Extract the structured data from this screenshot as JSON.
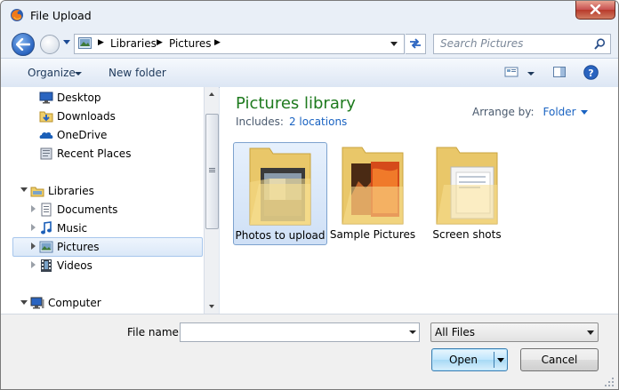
{
  "window": {
    "title": "File Upload",
    "icons": {
      "app": "firefox-icon",
      "close": "close-icon"
    }
  },
  "nav": {
    "breadcrumbs": [
      "Libraries",
      "Pictures"
    ],
    "search_placeholder": "Search Pictures",
    "icons": {
      "back": "back-arrow-icon",
      "forward": "forward-arrow-icon",
      "refresh": "refresh-icon",
      "search": "search-icon",
      "library": "library-icon"
    }
  },
  "toolbar": {
    "organize": "Organize",
    "new_folder": "New folder",
    "icons": {
      "views": "view-options-icon",
      "preview": "preview-pane-icon",
      "help": "help-icon"
    }
  },
  "sidebar": {
    "favorites": [
      {
        "label": "Desktop",
        "icon": "desktop-icon"
      },
      {
        "label": "Downloads",
        "icon": "downloads-icon"
      },
      {
        "label": "OneDrive",
        "icon": "onedrive-icon"
      },
      {
        "label": "Recent Places",
        "icon": "recent-places-icon"
      }
    ],
    "libraries": {
      "label": "Libraries",
      "icon": "libraries-icon"
    },
    "library_items": [
      {
        "label": "Documents",
        "icon": "documents-icon"
      },
      {
        "label": "Music",
        "icon": "music-icon"
      },
      {
        "label": "Pictures",
        "icon": "pictures-icon",
        "selected": true
      },
      {
        "label": "Videos",
        "icon": "videos-icon"
      }
    ],
    "computer": {
      "label": "Computer",
      "icon": "computer-icon"
    }
  },
  "content": {
    "title": "Pictures library",
    "includes_label": "Includes:",
    "includes_link": "2 locations",
    "arrange_label": "Arrange by:",
    "arrange_value": "Folder",
    "folders": [
      {
        "name": "Photos to upload",
        "selected": true
      },
      {
        "name": "Sample Pictures",
        "selected": false
      },
      {
        "name": "Screen shots",
        "selected": false
      }
    ]
  },
  "footer": {
    "file_name_label": "File name:",
    "file_name_value": "",
    "filter_value": "All Files",
    "open_label": "Open",
    "cancel_label": "Cancel"
  },
  "colors": {
    "library_title": "#1e7a1e",
    "link": "#1a63c2",
    "selection": "#cfe0f6"
  }
}
